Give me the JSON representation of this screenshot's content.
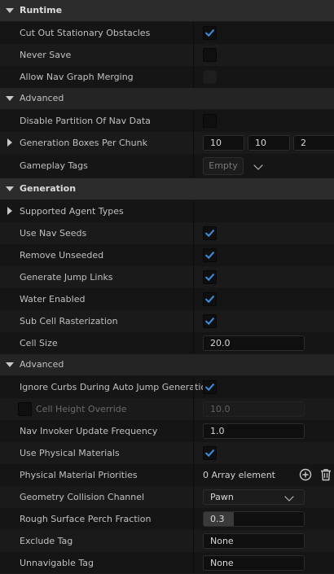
{
  "runtime": {
    "title": "Runtime",
    "cut_out_stationary_obstacles": {
      "label": "Cut Out Stationary Obstacles",
      "checked": true
    },
    "never_save": {
      "label": "Never Save",
      "checked": false
    },
    "allow_nav_graph_merging": {
      "label": "Allow Nav Graph Merging",
      "checked": false,
      "disabled": true
    },
    "advanced": {
      "title": "Advanced",
      "disable_partition": {
        "label": "Disable Partition Of Nav Data",
        "checked": false
      },
      "generation_boxes": {
        "label": "Generation Boxes Per Chunk",
        "x": "10",
        "y": "10",
        "z": "2"
      },
      "gameplay_tags": {
        "label": "Gameplay Tags",
        "value": "Empty"
      }
    }
  },
  "generation": {
    "title": "Generation",
    "supported_agent_types": {
      "label": "Supported Agent Types"
    },
    "use_nav_seeds": {
      "label": "Use Nav Seeds",
      "checked": true
    },
    "remove_unseeded": {
      "label": "Remove Unseeded",
      "checked": true
    },
    "generate_jump_links": {
      "label": "Generate Jump Links",
      "checked": true
    },
    "water_enabled": {
      "label": "Water Enabled",
      "checked": true
    },
    "sub_cell_rasterization": {
      "label": "Sub Cell Rasterization",
      "checked": true
    },
    "cell_size": {
      "label": "Cell Size",
      "value": "20.0"
    },
    "advanced": {
      "title": "Advanced",
      "ignore_curbs": {
        "label": "Ignore Curbs During Auto Jump Generation",
        "checked": true
      },
      "cell_height_override": {
        "label": "Cell Height Override",
        "value": "10.0",
        "checked": false
      },
      "nav_invoker_update_frequency": {
        "label": "Nav Invoker Update Frequency",
        "value": "1.0"
      },
      "use_physical_materials": {
        "label": "Use Physical Materials",
        "checked": true
      },
      "physical_material_priorities": {
        "label": "Physical Material Priorities",
        "value": "0 Array element"
      },
      "geometry_collision_channel": {
        "label": "Geometry Collision Channel",
        "value": "Pawn"
      },
      "rough_surface_perch_fraction": {
        "label": "Rough Surface Perch Fraction",
        "value": "0.3",
        "fraction": 0.3
      },
      "exclude_tag": {
        "label": "Exclude Tag",
        "value": "None"
      },
      "unnavigable_tag": {
        "label": "Unnavigable Tag",
        "value": "None"
      }
    }
  },
  "colors": {
    "check_accent": "#3d8fe0",
    "background": "#1a1a1a",
    "section_header": "#2c2c2c"
  }
}
